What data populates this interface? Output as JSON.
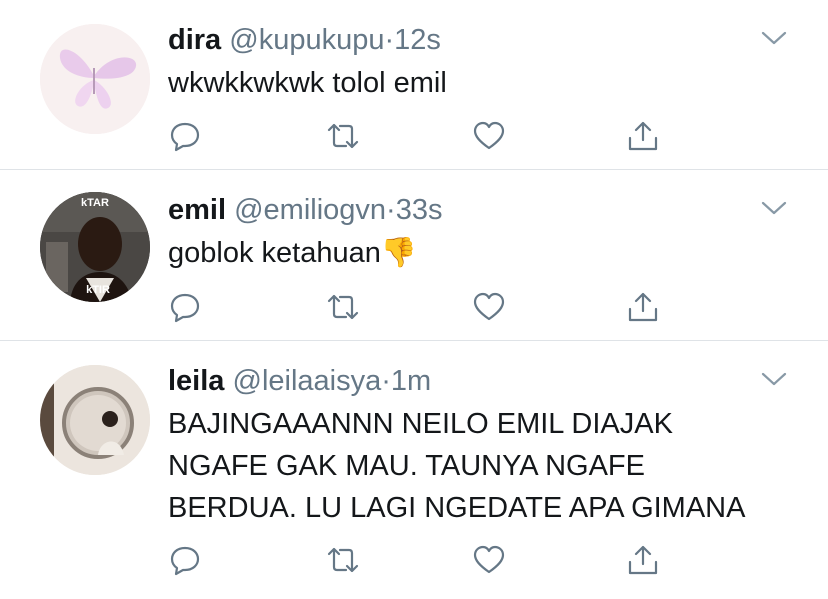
{
  "tweets": [
    {
      "name": "dira",
      "handle": "@kupukupu",
      "dot": "·",
      "time": "12s",
      "lines": [
        "wkwkkwkwk tolol emil"
      ]
    },
    {
      "name": "emil",
      "handle": "@emiliogvn",
      "dot": "·",
      "time": "33s",
      "lines": [
        "goblok ketahuan"
      ],
      "emoji": "👎",
      "avatar_text_top": "kTAR",
      "avatar_text_bottom": "kTIR"
    },
    {
      "name": "leila",
      "handle": "@leilaaisya",
      "dot": "·",
      "time": "1m",
      "lines": [
        "BAJINGAAANNN NEILO EMIL DIAJAK",
        "NGAFE GAK MAU. TAUNYA NGAFE",
        "BERDUA. LU LAGI NGEDATE APA GIMANA"
      ]
    }
  ],
  "colors": {
    "icon_gray": "#657786",
    "divider": "#dfe3e7",
    "name": "#14171a"
  },
  "icons": [
    "reply-icon",
    "retweet-icon",
    "like-icon",
    "share-icon",
    "chevron-down-icon"
  ]
}
